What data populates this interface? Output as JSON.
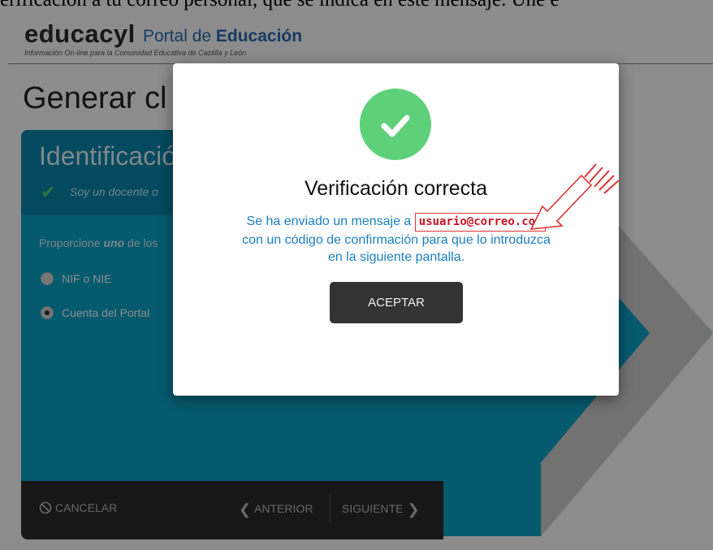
{
  "caption": "erificación a tu correo personal, que se indica en este mensaje. Une e",
  "header": {
    "logo": "educacyl",
    "portal_prefix": "Portal de ",
    "portal_strong": "Educación",
    "tagline": "Información On-line para la Comunidad Educativa de Castilla y León"
  },
  "page_title": "Generar cl",
  "panel": {
    "title": "Identificació",
    "subtitle": "Soy un docente o",
    "prompt_pre": "Proporcione ",
    "prompt_em": "uno",
    "prompt_post": " de los",
    "options": [
      {
        "label": "NIF o NIE",
        "selected": false
      },
      {
        "label": "Cuenta del Portal",
        "selected": true
      }
    ]
  },
  "footer": {
    "cancel": "CANCELAR",
    "prev": "ANTERIOR",
    "next": "SIGUIENTE"
  },
  "modal": {
    "title": "Verificación correcta",
    "msg_before": "Se ha enviado un mensaje a ",
    "email": "usuario@correo.com",
    "msg_after": "con un código de confirmación para que lo introduzca en la siguiente pantalla.",
    "accept": "ACEPTAR"
  },
  "colors": {
    "panel": "#0aa5c9",
    "panel_head": "#0787ad",
    "success": "#5fd07a",
    "link_blue": "#1a7fbf",
    "highlight_red": "#cc1122"
  }
}
